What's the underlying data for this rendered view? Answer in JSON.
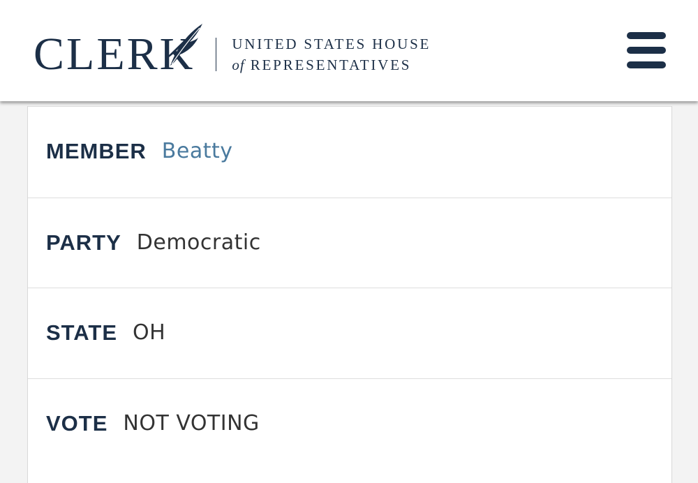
{
  "header": {
    "logo_main": "CLERK",
    "logo_line1": "UNITED STATES HOUSE",
    "logo_of": "of",
    "logo_line2": "REPRESENTATIVES",
    "menu_icon": "hamburger-menu-icon"
  },
  "details": [
    {
      "label": "MEMBER",
      "value": "Beatty"
    },
    {
      "label": "PARTY",
      "value": "Democratic"
    },
    {
      "label": "STATE",
      "value": "OH"
    },
    {
      "label": "VOTE",
      "value": "NOT VOTING"
    }
  ],
  "colors": {
    "brand_navy": "#1c2f47",
    "link_blue": "#4a7a9e",
    "text_gray": "#333333"
  }
}
